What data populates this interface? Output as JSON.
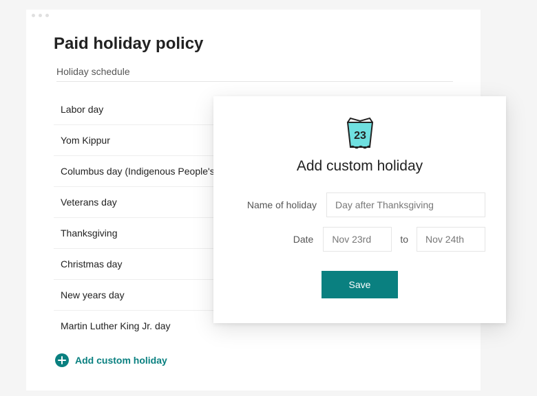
{
  "page": {
    "title": "Paid holiday policy",
    "sectionLabel": "Holiday schedule"
  },
  "holidays": [
    "Labor day",
    "Yom Kippur",
    "Columbus day (Indigenous People's day)",
    "Veterans day",
    "Thanksgiving",
    "Christmas day",
    "New years day",
    "Martin Luther King Jr. day"
  ],
  "addLink": {
    "label": "Add custom holiday"
  },
  "modal": {
    "iconNumber": "23",
    "title": "Add custom holiday",
    "nameLabel": "Name of holiday",
    "nameValue": "Day after Thanksgiving",
    "dateLabel": "Date",
    "dateFrom": "Nov 23rd",
    "dateToLabel": "to",
    "dateTo": "Nov 24th",
    "saveLabel": "Save"
  },
  "colors": {
    "accent": "#0a8080"
  }
}
